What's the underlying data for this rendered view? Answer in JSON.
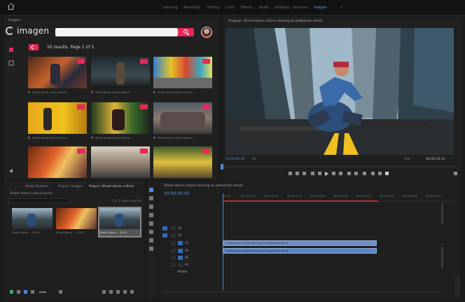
{
  "workspaces": [
    "Learning",
    "Assembly",
    "Editing",
    "Color",
    "Effects",
    "Audio",
    "Graphics",
    "Libraries",
    "Imagen"
  ],
  "active_workspace": "Imagen",
  "plugin": {
    "tab_label": "Imagen",
    "logo_text": "imagen",
    "search_value": "",
    "results_text": "50 results. Page 1 of 5",
    "accent_color": "#e8275a",
    "thumbnails": [
      {
        "caption": "Street dance culture dance..."
      },
      {
        "caption": "Street dance culture dance..."
      },
      {
        "caption": "Street dance culture dance..."
      },
      {
        "caption": "Street dance culture dance..."
      },
      {
        "caption": "Street dance culture dance..."
      },
      {
        "caption": "Street dance culture dance..."
      },
      {
        "caption": ""
      },
      {
        "caption": ""
      },
      {
        "caption": ""
      }
    ]
  },
  "program": {
    "title": "Program: Street dance culture dancing on pedestrian street",
    "timecode_left": "00:00:00:00",
    "zoom": "Fit",
    "quality": "Full",
    "timecode_right": "00:00:16:15"
  },
  "project": {
    "tabs": [
      "Media Browser",
      "Project: Imagen",
      "Project: Street dance culture"
    ],
    "active_tab": 2,
    "bin": "Street dance culture.prproj",
    "items_count": "3 of 3 items selected",
    "clips": [
      {
        "label": "Street Dance ... 16:15"
      },
      {
        "label": "Street Dance ... 10:00"
      },
      {
        "label": "Street Dance ... 16:15"
      }
    ]
  },
  "timeline": {
    "title": "Street dance culture dancing on pedestrian street",
    "timecode": "00:00:00:00",
    "ruler_ticks": [
      ":00:00",
      "00:00:05:00",
      "00:00:10:00",
      "00:00:15:00",
      "00:00:20:00",
      "00:00:25:00",
      "00:00:30:00",
      "00:00:35:00",
      "00:00:40:00",
      "00:00:45:00"
    ],
    "tracks": [
      {
        "name": "V3"
      },
      {
        "name": "V2"
      },
      {
        "name": "V1"
      },
      {
        "name": "A1"
      },
      {
        "name": "A2"
      },
      {
        "name": "A3"
      },
      {
        "name": "Master"
      }
    ],
    "clips": [
      {
        "track": "V1",
        "label": "Street dance culture dancing on pedestrian street"
      },
      {
        "track": "A1",
        "label": "Street dance culture dancing on pedestrian street"
      }
    ]
  }
}
